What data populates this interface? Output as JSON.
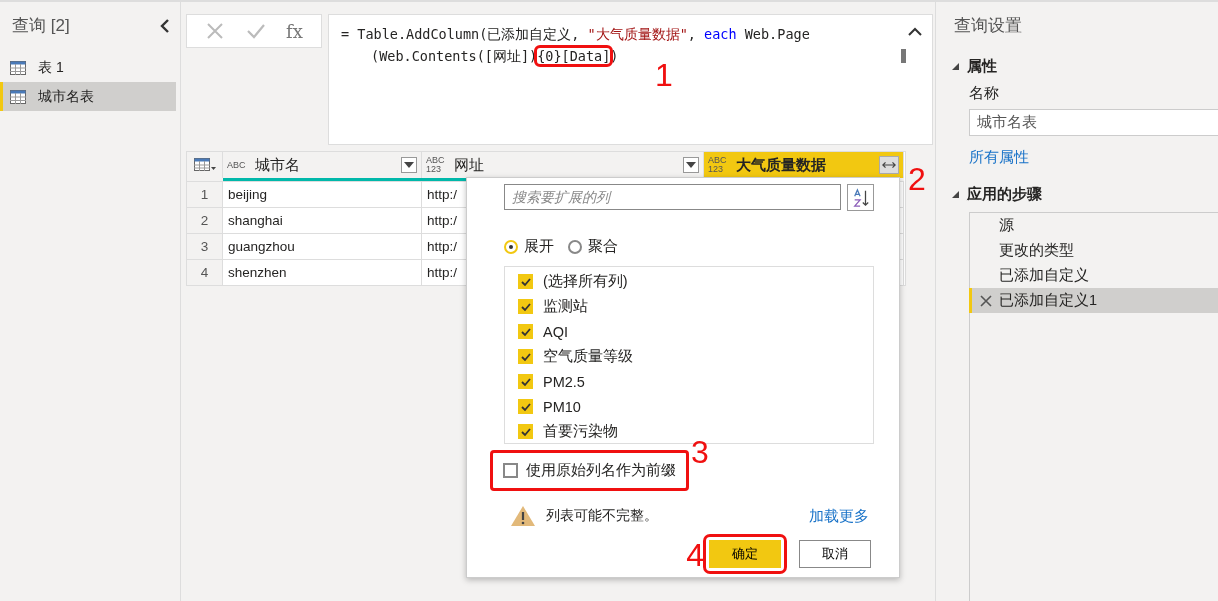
{
  "queries": {
    "title": "查询 [2]",
    "items": [
      {
        "label": "表 1",
        "selected": false
      },
      {
        "label": "城市名表",
        "selected": true
      }
    ]
  },
  "formula": {
    "function_label": "fx",
    "segments": [
      {
        "text": "= Table.AddColumn(已添加自定义, ",
        "kind": "plain"
      },
      {
        "text": "\"大气质量数据\"",
        "kind": "string"
      },
      {
        "text": ", ",
        "kind": "plain"
      },
      {
        "text": "each",
        "kind": "keyword"
      },
      {
        "text": " Web.Page",
        "kind": "plain"
      },
      {
        "text": "(Web.Contents([网址])",
        "kind": "plain",
        "break": true
      },
      {
        "text": "{0}[Data]",
        "kind": "number",
        "annotation": "1"
      },
      {
        "text": ")",
        "kind": "plain"
      }
    ]
  },
  "table": {
    "columns": [
      {
        "type": "ABC",
        "name": "城市名",
        "kind": "filter",
        "selected": false
      },
      {
        "type": "ABC 123",
        "name": "网址",
        "kind": "filter",
        "selected": false
      },
      {
        "type": "ABC 123",
        "name": "大气质量数据",
        "kind": "expand",
        "selected": true,
        "annotation": "2"
      }
    ],
    "rows": [
      {
        "index": "1",
        "cells": [
          "beijing",
          "http:/"
        ]
      },
      {
        "index": "2",
        "cells": [
          "shanghai",
          "http:/"
        ]
      },
      {
        "index": "3",
        "cells": [
          "guangzhou",
          "http:/"
        ]
      },
      {
        "index": "4",
        "cells": [
          "shenzhen",
          "http:/"
        ]
      }
    ]
  },
  "expand_popup": {
    "search": {
      "placeholder": "搜索要扩展的列"
    },
    "modes": [
      {
        "label": "展开",
        "selected": true
      },
      {
        "label": "聚合",
        "selected": false
      }
    ],
    "columns": [
      {
        "label": "(选择所有列)",
        "checked": true
      },
      {
        "label": "监测站",
        "checked": true
      },
      {
        "label": "AQI",
        "checked": true
      },
      {
        "label": "空气质量等级",
        "checked": true
      },
      {
        "label": "PM2.5",
        "checked": true
      },
      {
        "label": "PM10",
        "checked": true
      },
      {
        "label": "首要污染物",
        "checked": true
      }
    ],
    "prefix_option": {
      "label": "使用原始列名作为前缀",
      "checked": false,
      "annotation": "3"
    },
    "warning": "列表可能不完整。",
    "load_more": "加载更多",
    "buttons": [
      {
        "label": "确定",
        "kind": "primary",
        "annotation": "4"
      },
      {
        "label": "取消",
        "kind": "secondary"
      }
    ]
  },
  "settings": {
    "title": "查询设置",
    "properties": {
      "heading": "属性",
      "name_label": "名称",
      "name_value": "城市名表",
      "all_properties": "所有属性"
    },
    "steps_heading": "应用的步骤",
    "steps": [
      {
        "label": "源",
        "selected": false
      },
      {
        "label": "更改的类型",
        "selected": false
      },
      {
        "label": "已添加自定义",
        "selected": false
      },
      {
        "label": "已添加自定义1",
        "selected": true
      }
    ]
  }
}
